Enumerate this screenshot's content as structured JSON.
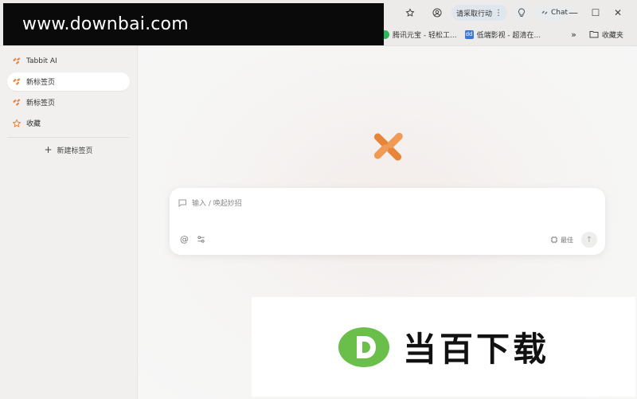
{
  "watermark_top": {
    "text": "www.downbai.com"
  },
  "toolbar": {
    "action_pill": "请采取行动",
    "chat_label": "Chat"
  },
  "bookmarks": [
    {
      "label": "腾讯元宝 - 轻松工...",
      "color": "#2eb85c"
    },
    {
      "label": "低端影视 - 超清在...",
      "color": "#3a78d8"
    }
  ],
  "bookmarks_folder": "收藏夹",
  "sidebar": {
    "items": [
      {
        "label": "Tabbit AI",
        "icon": "tabbit-icon"
      },
      {
        "label": "新标签页",
        "icon": "tabbit-icon",
        "active": true
      },
      {
        "label": "新标签页",
        "icon": "tabbit-icon"
      },
      {
        "label": "收藏",
        "icon": "star-icon"
      }
    ],
    "new_tab_label": "新建标签页"
  },
  "input": {
    "placeholder": "输入 / 唤起妙招",
    "model_label": "最佳"
  },
  "watermark_bottom": {
    "text": "当百下载"
  },
  "colors": {
    "accent": "#e8833a",
    "watermark_green": "#6abf4b"
  }
}
